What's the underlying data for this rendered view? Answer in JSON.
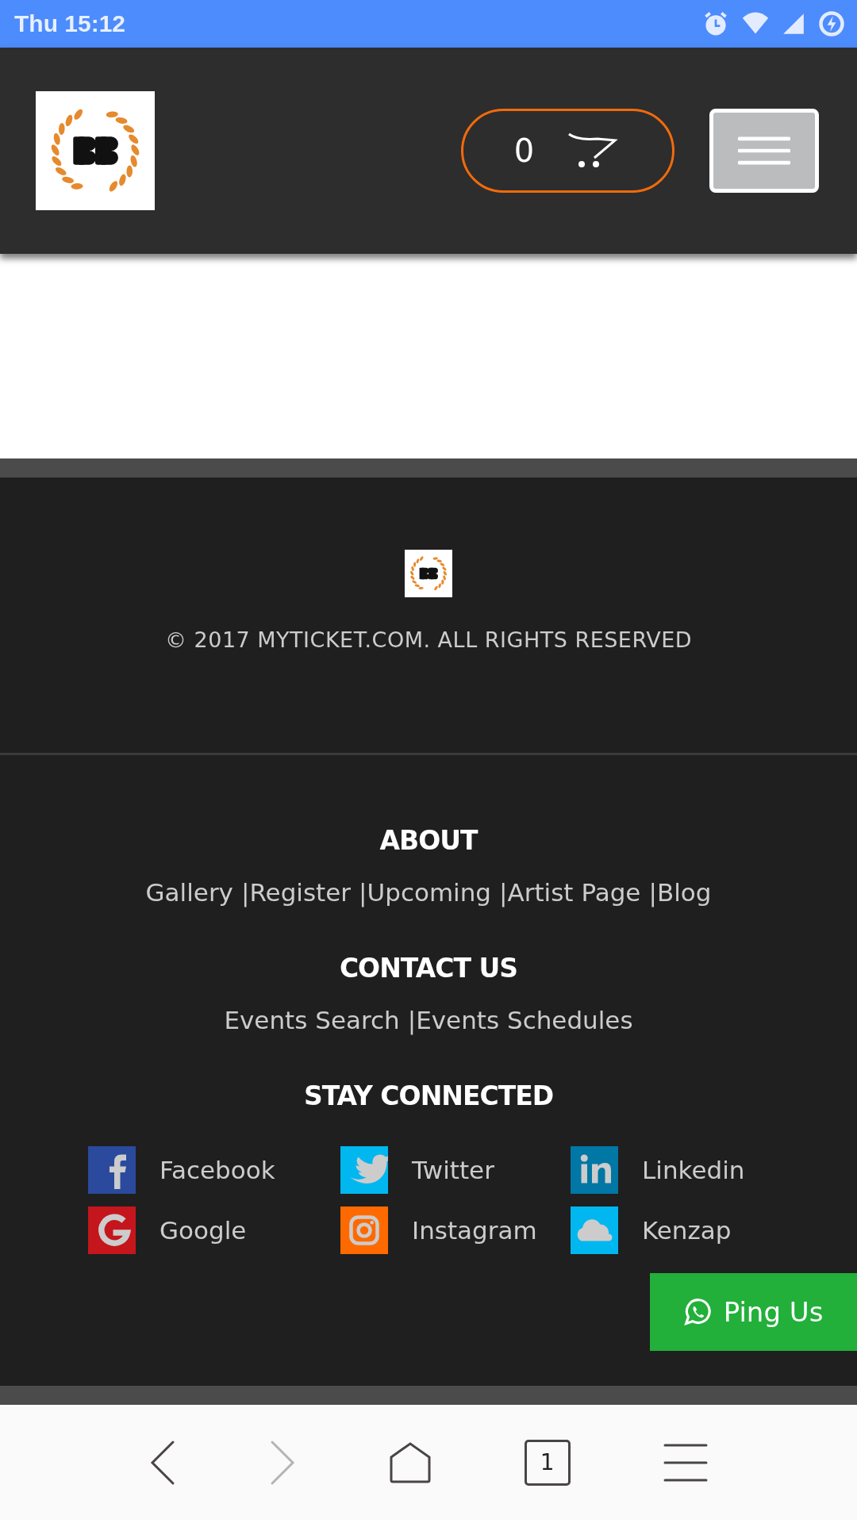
{
  "status_bar": {
    "time": "Thu 15:12"
  },
  "header": {
    "cart_count": "0"
  },
  "footer": {
    "copyright": "© 2017 MYTICKET.COM. ALL RIGHTS RESERVED",
    "sections": [
      {
        "heading": "ABOUT",
        "links": [
          "Gallery",
          "Register",
          "Upcoming",
          "Artist Page",
          "Blog"
        ]
      },
      {
        "heading": "CONTACT US",
        "links": [
          "Events Search",
          "Events Schedules"
        ]
      }
    ],
    "separator": "|",
    "social_heading": "STAY CONNECTED",
    "social": [
      {
        "label": "Facebook",
        "kind": "facebook",
        "color": "#2b4a9d"
      },
      {
        "label": "Twitter",
        "kind": "twitter",
        "color": "#00b7f0"
      },
      {
        "label": "Linkedin",
        "kind": "linkedin",
        "color": "#0077a5"
      },
      {
        "label": "Google",
        "kind": "google",
        "color": "#c4161c"
      },
      {
        "label": "Instagram",
        "kind": "instagram",
        "color": "#ff6a00"
      },
      {
        "label": "Kenzap",
        "kind": "cloud",
        "color": "#00b7f0"
      }
    ]
  },
  "ping_button": {
    "label": "Ping Us"
  },
  "browser_nav": {
    "tab_count": "1",
    "forward_disabled": true
  }
}
